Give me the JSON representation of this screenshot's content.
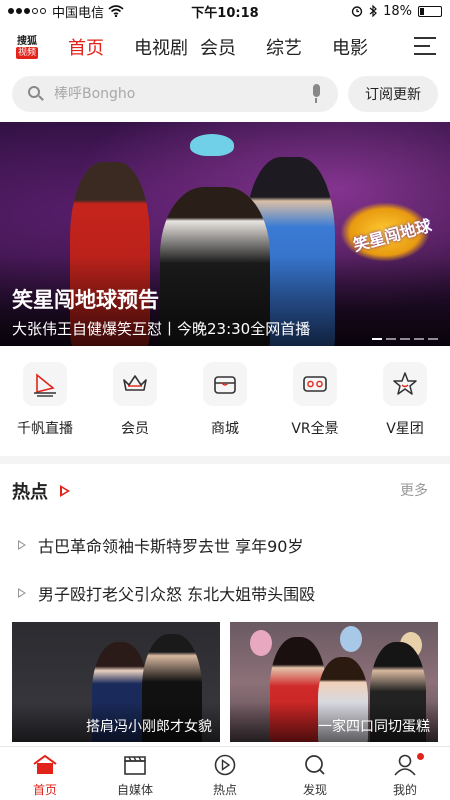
{
  "status_bar": {
    "carrier": "中国电信",
    "time": "下午10:18",
    "battery": "18%",
    "battery_level": 0.18
  },
  "logo": {
    "top": "搜狐",
    "bottom": "视频"
  },
  "nav": {
    "tabs": [
      {
        "label": "首页",
        "active": true
      },
      {
        "label": "电视剧",
        "active": false
      },
      {
        "label": "会员",
        "active": false
      },
      {
        "label": "综艺",
        "active": false
      },
      {
        "label": "电影",
        "active": false
      }
    ]
  },
  "search": {
    "placeholder": "棒呼Bongho",
    "subscribe_label": "订阅更新"
  },
  "banner": {
    "title": "笑星闯地球预告",
    "subtitle": "大张伟王自健爆笑互怼丨今晚23:30全网首播",
    "show_logo_text": "笑星闯地球"
  },
  "quick_links": [
    {
      "label": "千帆直播",
      "icon": "sail-icon"
    },
    {
      "label": "会员",
      "icon": "crown-icon"
    },
    {
      "label": "商城",
      "icon": "store-icon"
    },
    {
      "label": "VR全景",
      "icon": "vr-goggles-icon"
    },
    {
      "label": "V星团",
      "icon": "star-icon"
    }
  ],
  "hot": {
    "title": "热点",
    "more": "更多",
    "news": [
      "古巴革命领袖卡斯特罗去世 享年90岁",
      "男子殴打老父引众怒 东北大姐带头围殴"
    ],
    "cards": [
      {
        "caption": "搭肩冯小刚郎才女貌"
      },
      {
        "caption": "一家四口同切蛋糕"
      }
    ]
  },
  "tab_bar": {
    "items": [
      {
        "label": "首页",
        "icon": "home-icon",
        "active": true
      },
      {
        "label": "自媒体",
        "icon": "clapperboard-icon",
        "active": false
      },
      {
        "label": "热点",
        "icon": "play-circle-icon",
        "active": false
      },
      {
        "label": "发现",
        "icon": "search-icon",
        "active": false
      },
      {
        "label": "我的",
        "icon": "user-icon",
        "active": false
      }
    ]
  },
  "colors": {
    "accent": "#e2231a",
    "text": "#222222",
    "muted": "#999999",
    "search_bg": "#efefef"
  }
}
